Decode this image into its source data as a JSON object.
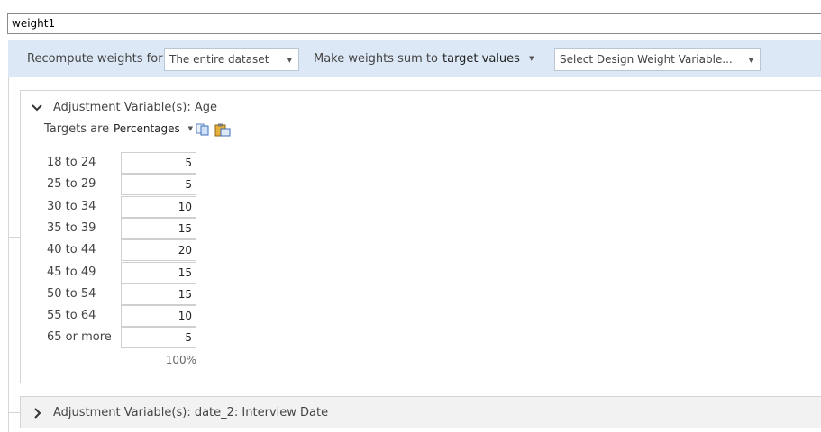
{
  "weight_name": "weight1",
  "toolbar": {
    "recompute_label": "Recompute weights for",
    "recompute_value": "The entire dataset",
    "sum_label": "Make weights sum to",
    "sum_value": "target values",
    "design_weight_placeholder": "Select Design Weight Variable..."
  },
  "age_panel": {
    "title": "Adjustment Variable(s): Age",
    "targets_label": "Targets are",
    "targets_value": "Percentages",
    "rows": [
      {
        "label": "18 to 24",
        "value": "5"
      },
      {
        "label": "25 to 29",
        "value": "5"
      },
      {
        "label": "30 to 34",
        "value": "10"
      },
      {
        "label": "35 to 39",
        "value": "15"
      },
      {
        "label": "40 to 44",
        "value": "20"
      },
      {
        "label": "45 to 49",
        "value": "15"
      },
      {
        "label": "50 to 54",
        "value": "15"
      },
      {
        "label": "55 to 64",
        "value": "10"
      },
      {
        "label": "65 or more",
        "value": "5"
      }
    ],
    "total": "100%"
  },
  "date_panel": {
    "title": "Adjustment Variable(s): date_2: Interview Date"
  },
  "icons": {
    "copy": "copy-icon",
    "paste": "paste-icon",
    "expanded": "chevron-down-icon",
    "collapsed": "chevron-right-icon"
  }
}
